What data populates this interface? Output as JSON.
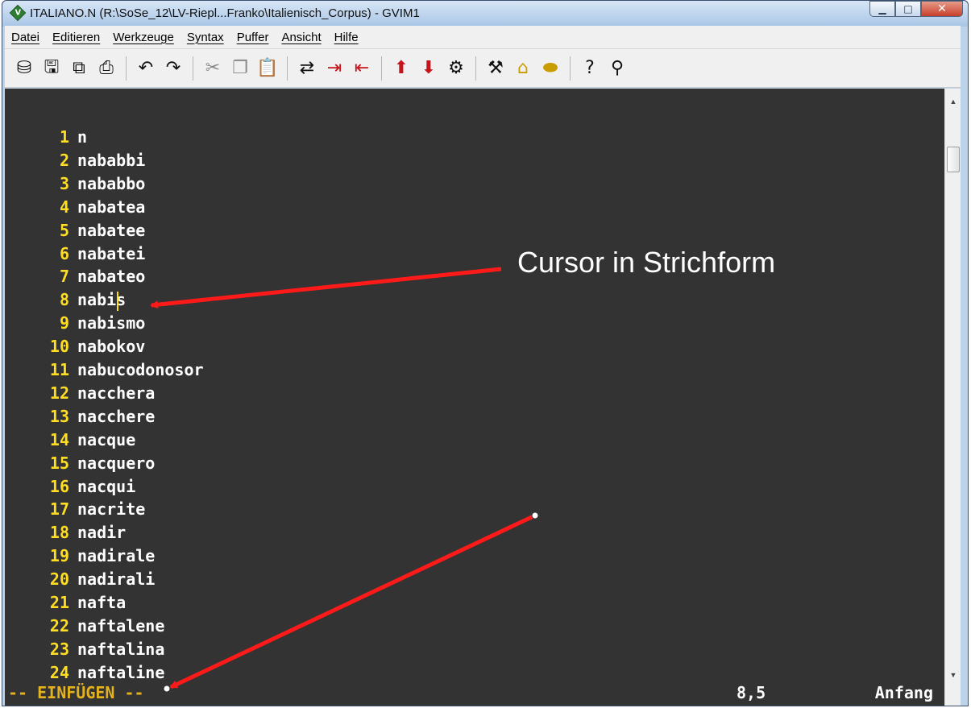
{
  "window": {
    "title": "ITALIANO.N (R:\\SoSe_12\\LV-Riepl...Franko\\Italienisch_Corpus) - GVIM1",
    "controls": {
      "minimize": "▁",
      "maximize": "□",
      "close": "✕"
    }
  },
  "menu": [
    "Datei",
    "Editieren",
    "Werkzeuge",
    "Syntax",
    "Puffer",
    "Ansicht",
    "Hilfe"
  ],
  "toolbar": {
    "groups": [
      [
        {
          "name": "open-icon",
          "glyph": "⛁"
        },
        {
          "name": "save-icon",
          "glyph": "🖫"
        },
        {
          "name": "save-all-icon",
          "glyph": "⧉"
        },
        {
          "name": "print-icon",
          "glyph": "⎙"
        }
      ],
      [
        {
          "name": "undo-icon",
          "glyph": "↶"
        },
        {
          "name": "redo-icon",
          "glyph": "↷"
        }
      ],
      [
        {
          "name": "cut-icon",
          "glyph": "✂",
          "dim": true
        },
        {
          "name": "copy-icon",
          "glyph": "❐",
          "dim": true
        },
        {
          "name": "paste-icon",
          "glyph": "📋"
        }
      ],
      [
        {
          "name": "replace-icon",
          "glyph": "⇄"
        },
        {
          "name": "find-next-icon",
          "glyph": "⇥",
          "red": true
        },
        {
          "name": "find-prev-icon",
          "glyph": "⇤",
          "red": true
        }
      ],
      [
        {
          "name": "load-session-icon",
          "glyph": "⬆",
          "red": true
        },
        {
          "name": "save-session-icon",
          "glyph": "⬇",
          "red": true
        },
        {
          "name": "run-script-icon",
          "glyph": "⚙"
        }
      ],
      [
        {
          "name": "make-icon",
          "glyph": "⚒"
        },
        {
          "name": "shell-icon",
          "glyph": "⌂",
          "yellow": true
        },
        {
          "name": "tags-icon",
          "glyph": "⬬",
          "yellow": true
        }
      ],
      [
        {
          "name": "help-icon",
          "glyph": "?"
        },
        {
          "name": "find-help-icon",
          "glyph": "⚲"
        }
      ]
    ]
  },
  "editor": {
    "lines": [
      {
        "num": "1",
        "text": "n"
      },
      {
        "num": "2",
        "text": "nababbi"
      },
      {
        "num": "3",
        "text": "nababbo"
      },
      {
        "num": "4",
        "text": "nabatea"
      },
      {
        "num": "5",
        "text": "nabatee"
      },
      {
        "num": "6",
        "text": "nabatei"
      },
      {
        "num": "7",
        "text": "nabateo"
      },
      {
        "num": "8",
        "text": "nabis"
      },
      {
        "num": "9",
        "text": "nabismo"
      },
      {
        "num": "10",
        "text": "nabokov"
      },
      {
        "num": "11",
        "text": "nabucodonosor"
      },
      {
        "num": "12",
        "text": "nacchera"
      },
      {
        "num": "13",
        "text": "nacchere"
      },
      {
        "num": "14",
        "text": "nacque"
      },
      {
        "num": "15",
        "text": "nacquero"
      },
      {
        "num": "16",
        "text": "nacqui"
      },
      {
        "num": "17",
        "text": "nacrite"
      },
      {
        "num": "18",
        "text": "nadir"
      },
      {
        "num": "19",
        "text": "nadirale"
      },
      {
        "num": "20",
        "text": "nadirali"
      },
      {
        "num": "21",
        "text": "nafta"
      },
      {
        "num": "22",
        "text": "naftalene"
      },
      {
        "num": "23",
        "text": "naftalina"
      },
      {
        "num": "24",
        "text": "naftaline"
      }
    ],
    "cursor_line": 8,
    "cursor_col": 5
  },
  "status": {
    "mode": "-- EINFÜGEN --",
    "position": "8,5",
    "scroll": "Anfang"
  },
  "annotation": {
    "text": "Cursor in Strichform",
    "color": "#ff1a1a"
  },
  "colors": {
    "editor_bg": "#333333",
    "line_number": "#ffdd22",
    "text": "#ffffff",
    "mode": "#e3b21e"
  }
}
